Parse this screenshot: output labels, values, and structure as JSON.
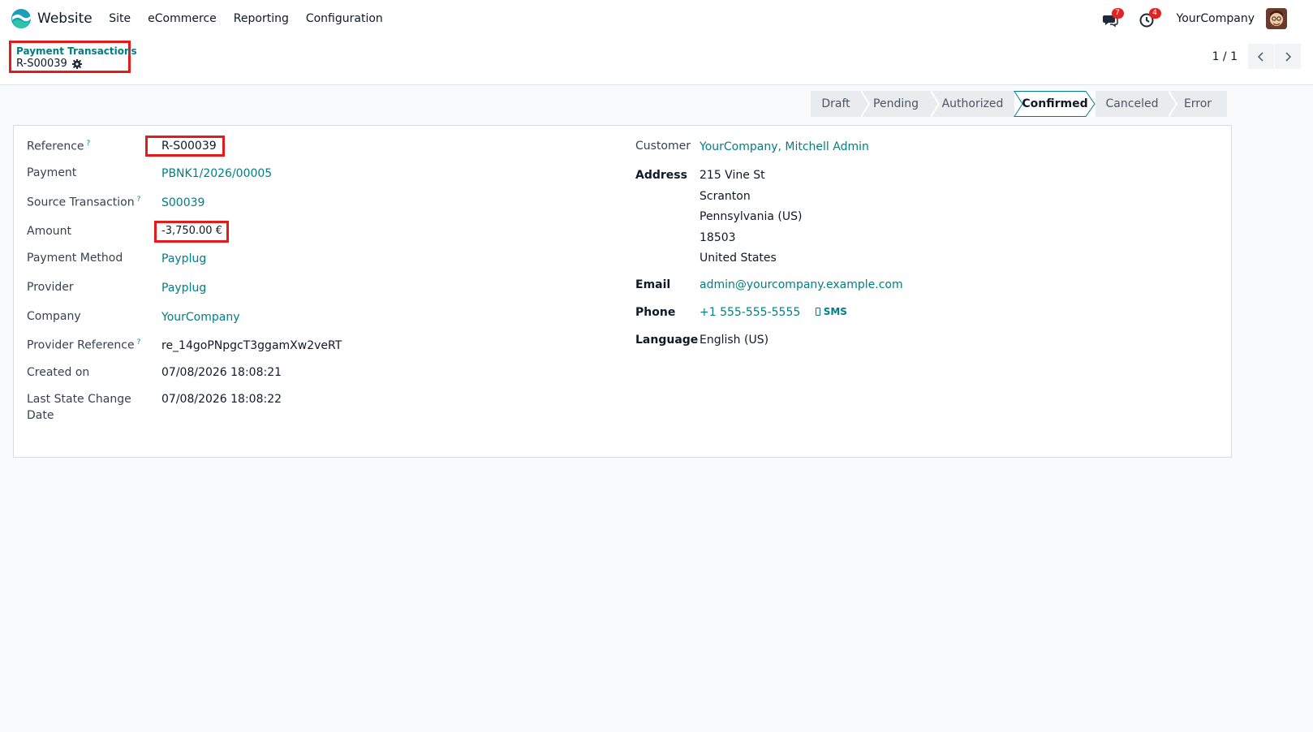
{
  "navbar": {
    "app_name": "Website",
    "menu": [
      "Site",
      "eCommerce",
      "Reporting",
      "Configuration"
    ],
    "messages_count": "7",
    "activities_count": "4",
    "company": "YourCompany"
  },
  "breadcrumb": {
    "parent": "Payment Transactions",
    "current": "R-S00039"
  },
  "pager": {
    "value": "1 / 1"
  },
  "statusbar": {
    "steps": [
      "Draft",
      "Pending",
      "Authorized",
      "Confirmed",
      "Canceled",
      "Error"
    ],
    "active": "Confirmed"
  },
  "form": {
    "left": {
      "reference_label": "Reference",
      "reference": "R-S00039",
      "payment_label": "Payment",
      "payment": "PBNK1/2026/00005",
      "source_label": "Source Transaction",
      "source": "S00039",
      "amount_label": "Amount",
      "amount": "-3,750.00 €",
      "method_label": "Payment Method",
      "method": "Payplug",
      "provider_label": "Provider",
      "provider": "Payplug",
      "company_label": "Company",
      "company": "YourCompany",
      "provider_ref_label": "Provider Reference",
      "provider_ref": "re_14goPNpgcT3ggamXw2veRT",
      "created_label": "Created on",
      "created": "07/08/2026 18:08:21",
      "last_state_label_1": "Last State Change",
      "last_state_label_2": "Date",
      "last_state": "07/08/2026 18:08:22"
    },
    "right": {
      "customer_label": "Customer",
      "customer": "YourCompany, Mitchell Admin",
      "address_label": "Address",
      "address": [
        "215 Vine St",
        "Scranton",
        "Pennsylvania (US)",
        "18503",
        "United States"
      ],
      "email_label": "Email",
      "email": "admin@yourcompany.example.com",
      "phone_label": "Phone",
      "phone": "+1 555-555-5555",
      "sms_label": "SMS",
      "language_label": "Language",
      "language": "English (US)"
    },
    "help_mark": "?"
  },
  "colors": {
    "accent": "#017e84",
    "highlight": "#e41b1b",
    "badge": "#e02424"
  }
}
